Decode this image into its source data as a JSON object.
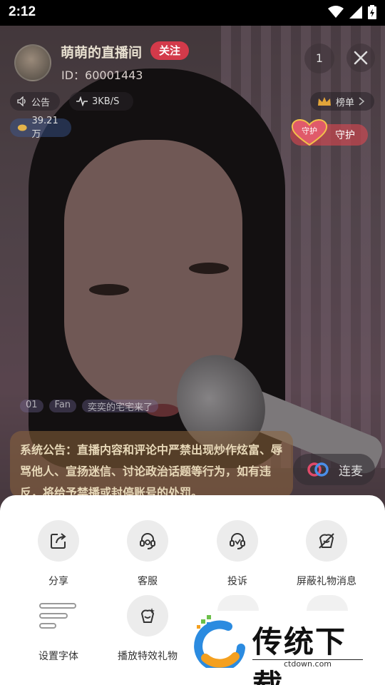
{
  "status_bar": {
    "time": "2:12"
  },
  "room": {
    "title": "萌萌的直播间",
    "follow_label": "关注",
    "id_text": "ID：60001443",
    "viewer_count": "1"
  },
  "info_pills": {
    "notice": "公告",
    "speed": "3KB/S",
    "rank": "榜单",
    "coins": "39.21万"
  },
  "guard": {
    "badge": "守护",
    "label": "守护"
  },
  "chat_strip": [
    "01",
    "Fan",
    "奕奕的宅宅来了"
  ],
  "system_announcement": "系统公告：直播内容和评论中严禁出现炒作炫富、辱骂他人、宣扬迷信、讨论政治话题等行为，如有违反，将给予禁播或封停账号的处罚。",
  "link_mic": {
    "label": "连麦"
  },
  "sheet": {
    "items": [
      {
        "label": "分享",
        "icon": "share-icon"
      },
      {
        "label": "客服",
        "icon": "headset-icon"
      },
      {
        "label": "投诉",
        "icon": "report-icon"
      },
      {
        "label": "屏蔽礼物消息",
        "icon": "gift-block-icon"
      },
      {
        "label": "设置字体",
        "icon": "font-lines-icon"
      },
      {
        "label": "播放特效礼物",
        "icon": "effect-gift-icon"
      }
    ]
  },
  "watermark": {
    "title": "传统下载",
    "url": "ctdown.com"
  },
  "colors": {
    "follow": "#d33a4a",
    "sheet_bg": "#ffffff",
    "icon_circle": "#ececec"
  }
}
